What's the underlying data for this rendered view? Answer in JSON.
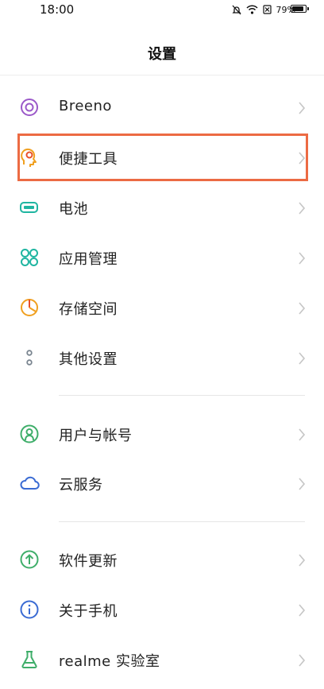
{
  "status_bar": {
    "time": "18:00",
    "battery_percent": "79%"
  },
  "header": {
    "title": "设置"
  },
  "items": [
    {
      "label": "Breeno",
      "icon": "breeno-icon",
      "color": "#9b59c9"
    },
    {
      "label": "便捷工具",
      "icon": "convenience-tools-icon",
      "color": "#f0a020"
    },
    {
      "label": "电池",
      "icon": "battery-icon",
      "color": "#1fb5a1"
    },
    {
      "label": "应用管理",
      "icon": "app-management-icon",
      "color": "#1fb5a1"
    },
    {
      "label": "存储空间",
      "icon": "storage-icon",
      "color": "#f0a020"
    },
    {
      "label": "其他设置",
      "icon": "other-settings-icon",
      "color": "#7a8590"
    },
    {
      "label": "用户与帐号",
      "icon": "user-account-icon",
      "color": "#3fae6a"
    },
    {
      "label": "云服务",
      "icon": "cloud-service-icon",
      "color": "#3a6bd3"
    },
    {
      "label": "软件更新",
      "icon": "software-update-icon",
      "color": "#3fae6a"
    },
    {
      "label": "关于手机",
      "icon": "about-phone-icon",
      "color": "#3a6bd3"
    },
    {
      "label": "realme 实验室",
      "icon": "realme-lab-icon",
      "color": "#3fae6a"
    }
  ],
  "highlight_color": "#ec6b43"
}
